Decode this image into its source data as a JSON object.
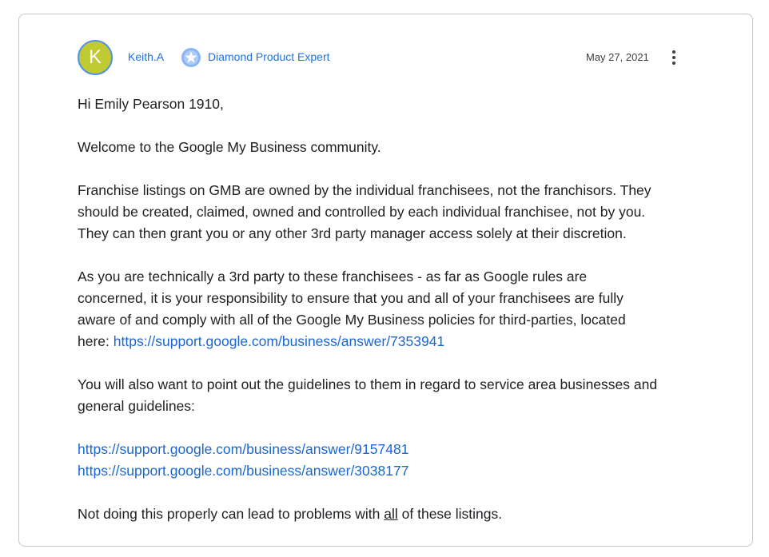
{
  "post": {
    "avatar_letter": "K",
    "avatar_color": "#c0ca33",
    "author": "Keith.A",
    "badge_icon": "diamond-badge-icon",
    "badge_label": "Diamond Product Expert",
    "date": "May 27, 2021",
    "menu_icon": "more-vert-icon"
  },
  "content": {
    "greeting": "Hi Emily Pearson 1910,",
    "welcome": "Welcome to the Google My Business community.",
    "p1": {
      "line1": "Franchise listings on GMB are owned by the individual franchisees, not the franchisors. They",
      "line2": "should be created, claimed, owned and controlled by each individual franchisee, not by you.",
      "line3": "They can then grant you or any other 3rd party manager access solely at their discretion."
    },
    "p2": {
      "line1": "As you are technically a 3rd party to these franchisees - as far as Google rules are",
      "line2": "concerned, it is your responsibility to ensure that you and all of your franchisees are fully",
      "line3": "aware of and comply with all of the Google My Business policies for third-parties, located",
      "line4_prefix": "here: ",
      "link": "https://support.google.com/business/answer/7353941"
    },
    "p3": {
      "line1": "You will also want to point out the guidelines to them in regard to service area businesses and",
      "line2": "general guidelines:"
    },
    "links": {
      "link1": "https://support.google.com/business/answer/9157481",
      "link2": "https://support.google.com/business/answer/3038177"
    },
    "closing": {
      "prefix": "Not doing this properly can lead to problems with ",
      "emphasis": "all",
      "suffix": " of these listings."
    }
  },
  "colors": {
    "link": "#1a67d2",
    "accent": "#1a73e8",
    "border": "#c4c7c5",
    "text": "#202124"
  }
}
